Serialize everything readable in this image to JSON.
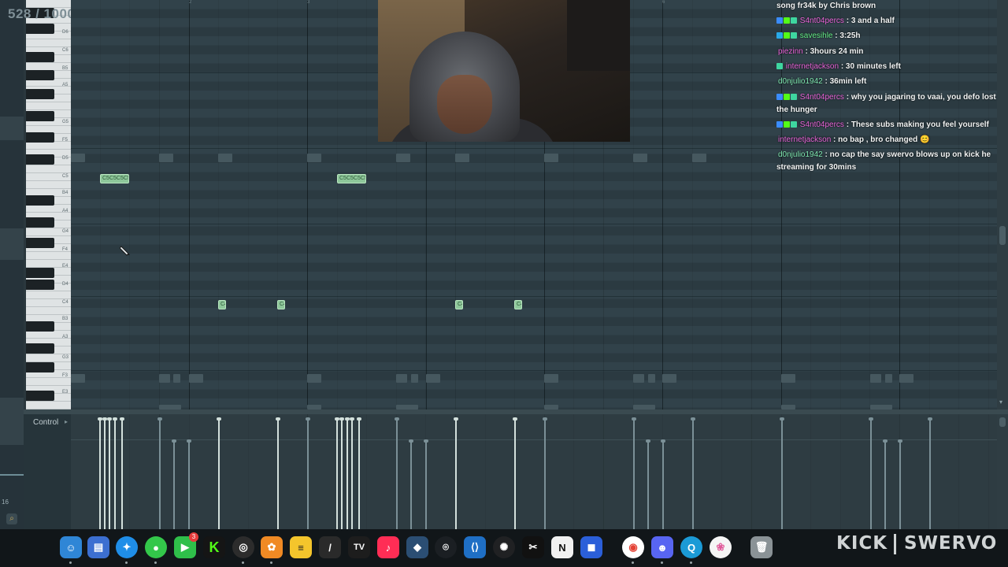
{
  "piano_roll": {
    "position_counter": "528 / 1000",
    "key_labels": [
      "D6",
      "C6",
      "B5",
      "A5",
      "G5",
      "F5",
      "D5",
      "C5",
      "B4",
      "A4",
      "G4",
      "F4",
      "E4",
      "D4",
      "C4",
      "B3",
      "A3",
      "G3",
      "F3",
      "E3"
    ],
    "notes": [
      {
        "label": "C5C5C5C5"
      },
      {
        "label": "C5C5C5C5"
      },
      {
        "label": "C4"
      },
      {
        "label": "C4"
      },
      {
        "label": "C4"
      },
      {
        "label": "C4"
      }
    ],
    "bar_numbers": [
      "2",
      "3",
      "6"
    ]
  },
  "control_lane": {
    "label": "Control",
    "arrow": "▸"
  },
  "chat": {
    "messages": [
      {
        "user": "",
        "text": "song fr34k by Chris brown",
        "user_color": "#ffffff"
      },
      {
        "user": "S4nt04percs",
        "text": " : 3 and a half",
        "user_color": "#e864d8"
      },
      {
        "user": "savesihle",
        "text": " : 3:25h",
        "user_color": "#66ee88"
      },
      {
        "user": "piezinn",
        "text": " : 3hours 24 min",
        "user_color": "#e864d8"
      },
      {
        "user": "internetjackson",
        "text": " : 30 minutes left",
        "user_color": "#e864d8"
      },
      {
        "user": "d0njulio1942",
        "text": " : 36min left",
        "user_color": "#7fe7b0"
      },
      {
        "user": "S4nt04percs",
        "text": " : why you jagaring to vaai, you defo lost the hunger",
        "user_color": "#e864d8"
      },
      {
        "user": "S4nt04percs",
        "text": " : These subs making you feel yourself",
        "user_color": "#e864d8"
      },
      {
        "user": "internetjackson",
        "text": " : no bap , bro changed 😊",
        "user_color": "#e864d8"
      },
      {
        "user": "d0njulio1942",
        "text": " : no cap the say swervo blows up on kick he streaming for 30mins",
        "user_color": "#7fe7b0"
      }
    ]
  },
  "left_strip": {
    "number": "16"
  },
  "dock": {
    "facetime_badge": "3",
    "apps": [
      "finder-icon",
      "files-icon",
      "safari-icon",
      "messages-icon",
      "facetime-icon",
      "kick-app-icon",
      "obs-icon",
      "fl-studio-icon",
      "notes-icon",
      "pen-icon",
      "tradingview-icon",
      "music-icon",
      "davinci-icon",
      "github-icon",
      "vscode-icon",
      "chatgpt-icon",
      "capcut-icon",
      "notion-icon",
      "roblox-icon",
      "chrome-icon",
      "discord-icon",
      "quicktime-icon",
      "photos-icon",
      "trash-icon"
    ]
  },
  "watermark": {
    "brand": "KICK",
    "channel": "SWERVO"
  }
}
